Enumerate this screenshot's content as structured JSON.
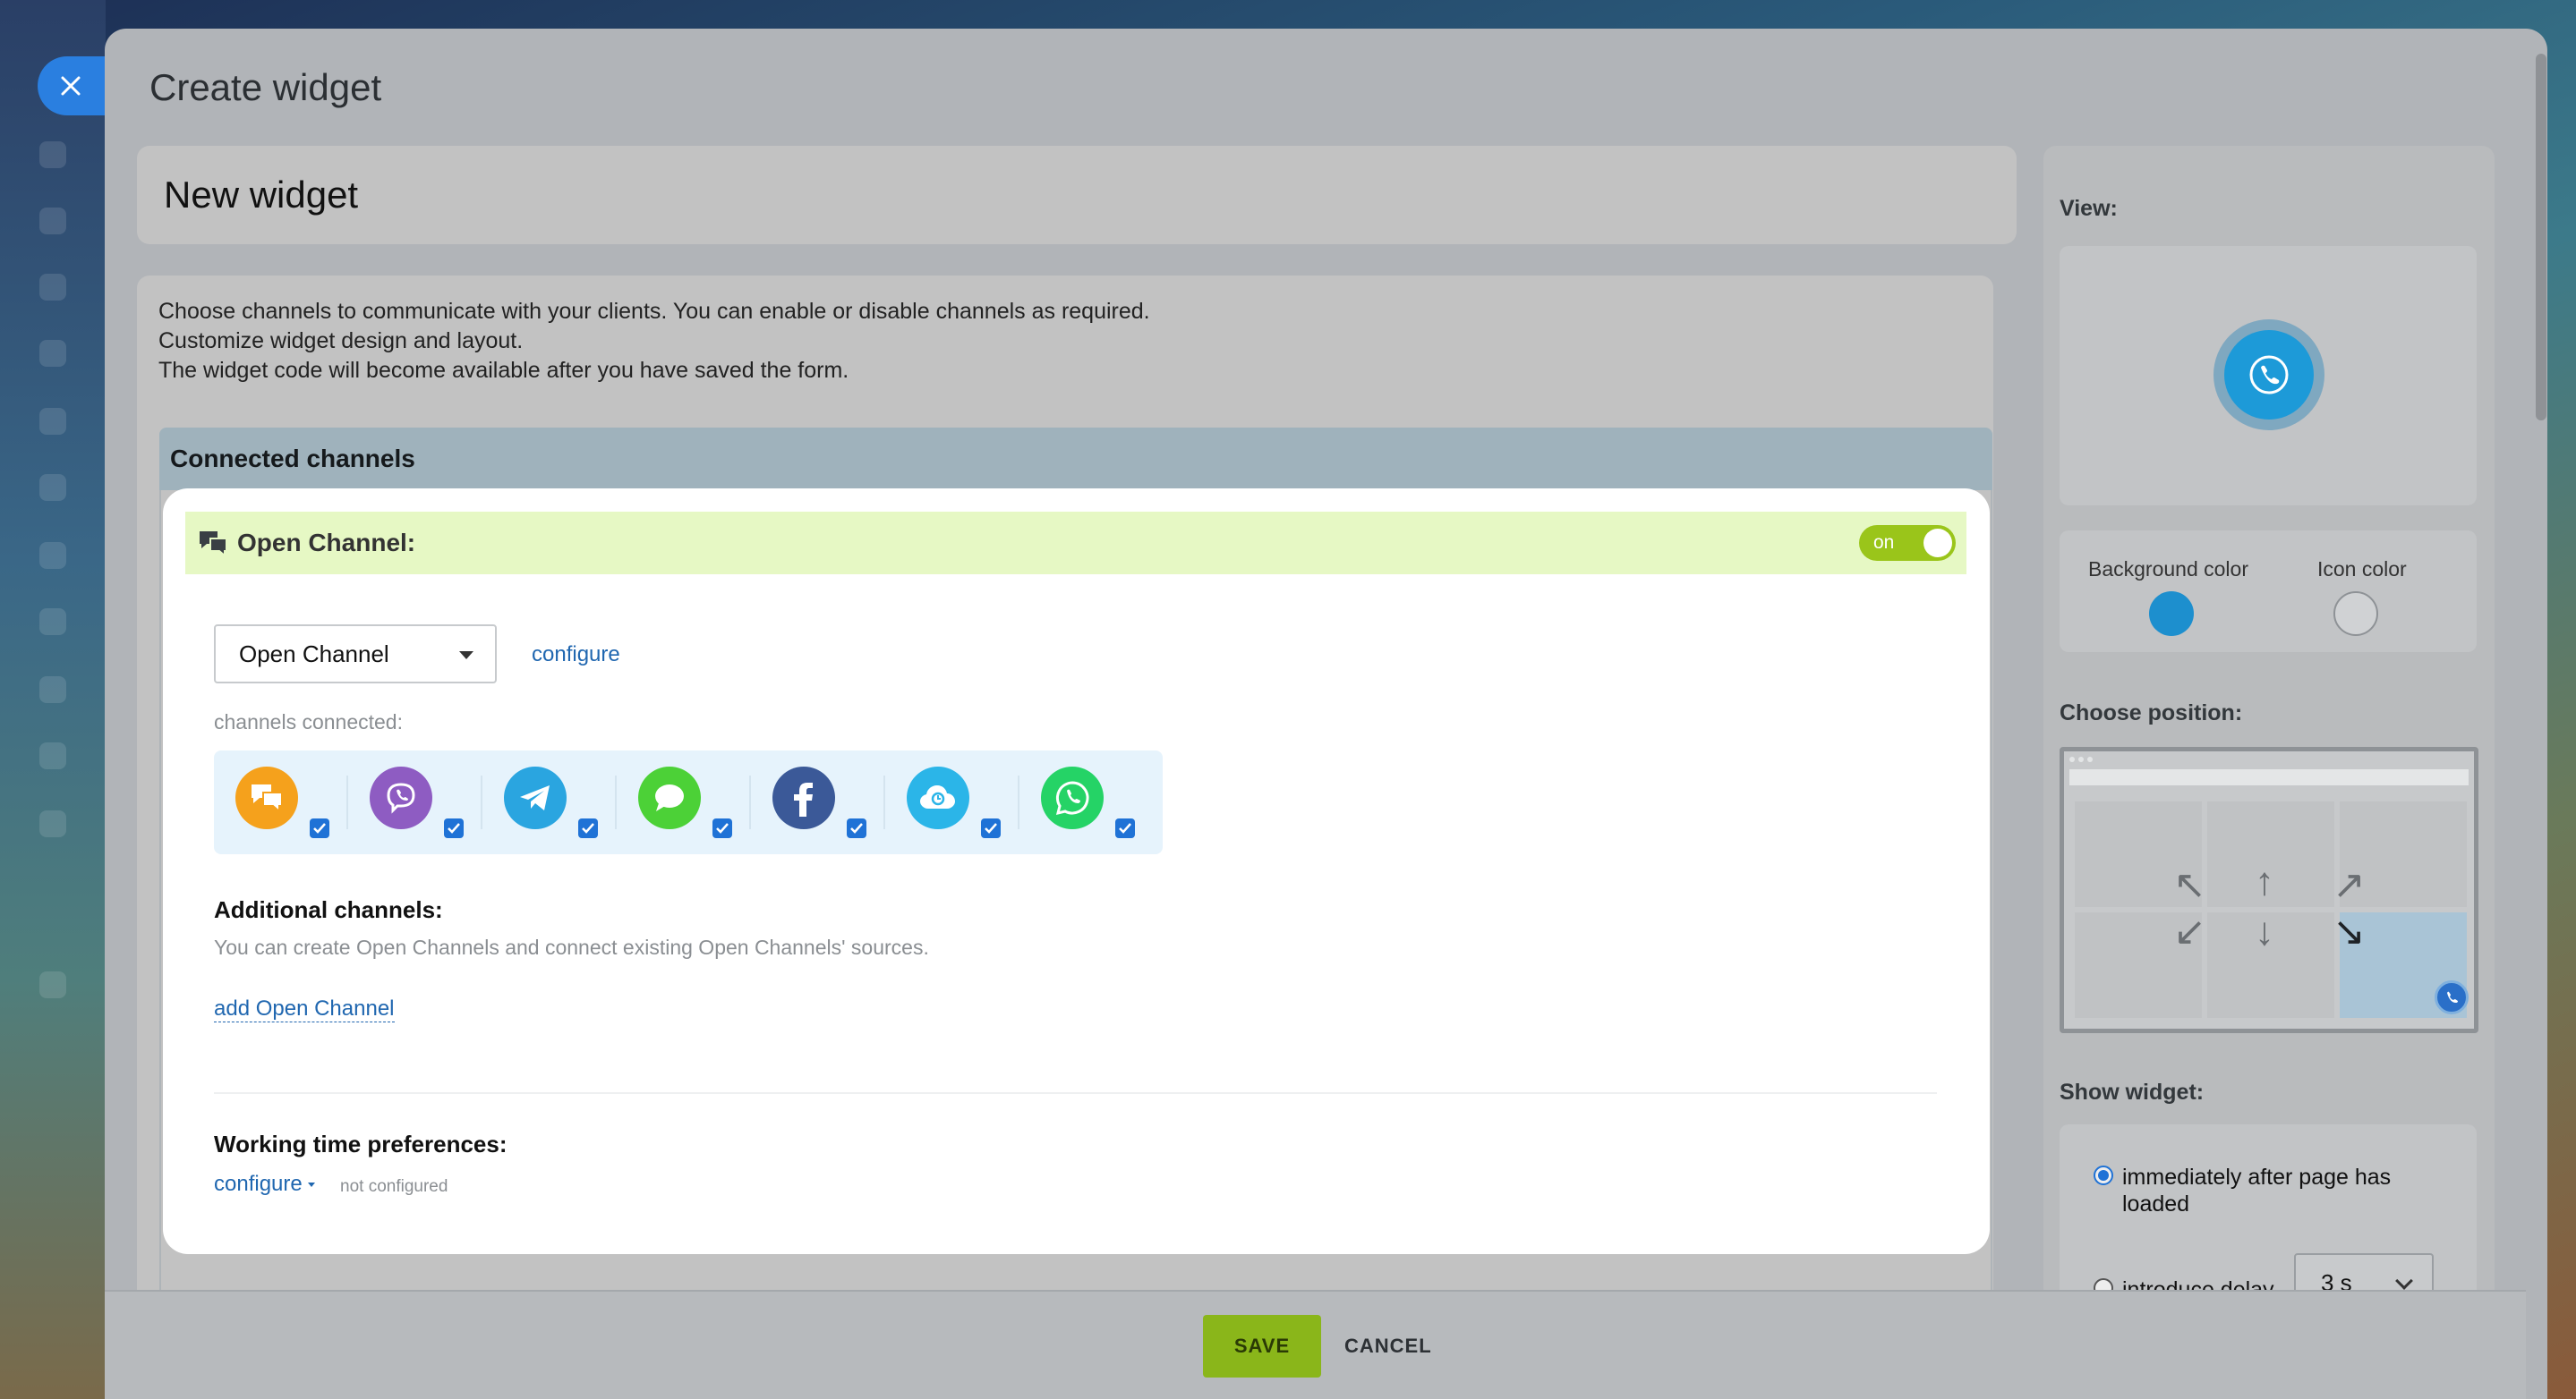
{
  "header": {
    "close_icon": "close-icon",
    "title": "Create widget"
  },
  "form": {
    "widget_name": "New widget",
    "intro_lines": [
      "Choose channels to communicate with your clients. You can enable or disable channels as required.",
      "Customize widget design and layout.",
      "The widget code will become available after you have saved the form."
    ],
    "connected_channels_title": "Connected channels"
  },
  "open_channel": {
    "title": "Open Channel:",
    "toggle_label": "on",
    "toggle_on": true,
    "select_value": "Open Channel",
    "configure_label": "configure",
    "channels_connected_label": "channels connected:",
    "channels": [
      {
        "name": "bitrix-chat",
        "icon": "chat-bubbles-icon",
        "color": "#f5a623",
        "checked": true
      },
      {
        "name": "viber",
        "icon": "viber-icon",
        "color": "#8e5cc2",
        "checked": true
      },
      {
        "name": "telegram",
        "icon": "telegram-icon",
        "color": "#2aa5e0",
        "checked": true
      },
      {
        "name": "imessage",
        "icon": "message-bubble-icon",
        "color": "#4cd137",
        "checked": true
      },
      {
        "name": "facebook",
        "icon": "facebook-icon",
        "color": "#3b5998",
        "checked": true
      },
      {
        "name": "cloud-chat",
        "icon": "cloud-chat-icon",
        "color": "#2bb5e8",
        "checked": true
      },
      {
        "name": "whatsapp",
        "icon": "whatsapp-icon",
        "color": "#25d366",
        "checked": true
      }
    ],
    "additional_title": "Additional channels:",
    "additional_desc": "You can create Open Channels and connect existing Open Channels' sources.",
    "add_link": "add Open Channel",
    "working_time_title": "Working time preferences:",
    "working_time_link": "configure",
    "working_time_status": "not configured"
  },
  "sidebar_settings": {
    "view_label": "View:",
    "background_color_label": "Background color",
    "background_color": "#1d9ad8",
    "icon_color_label": "Icon color",
    "icon_color": "#ffffff",
    "position_label": "Choose position:",
    "selected_position": "bottom-right",
    "show_widget_label": "Show widget:",
    "show_option_immediate": "immediately after page has loaded",
    "show_option_delay": "introduce delay",
    "show_selected": "immediate",
    "delay_value": "3 s"
  },
  "footer": {
    "save_label": "SAVE",
    "cancel_label": "CANCEL"
  }
}
